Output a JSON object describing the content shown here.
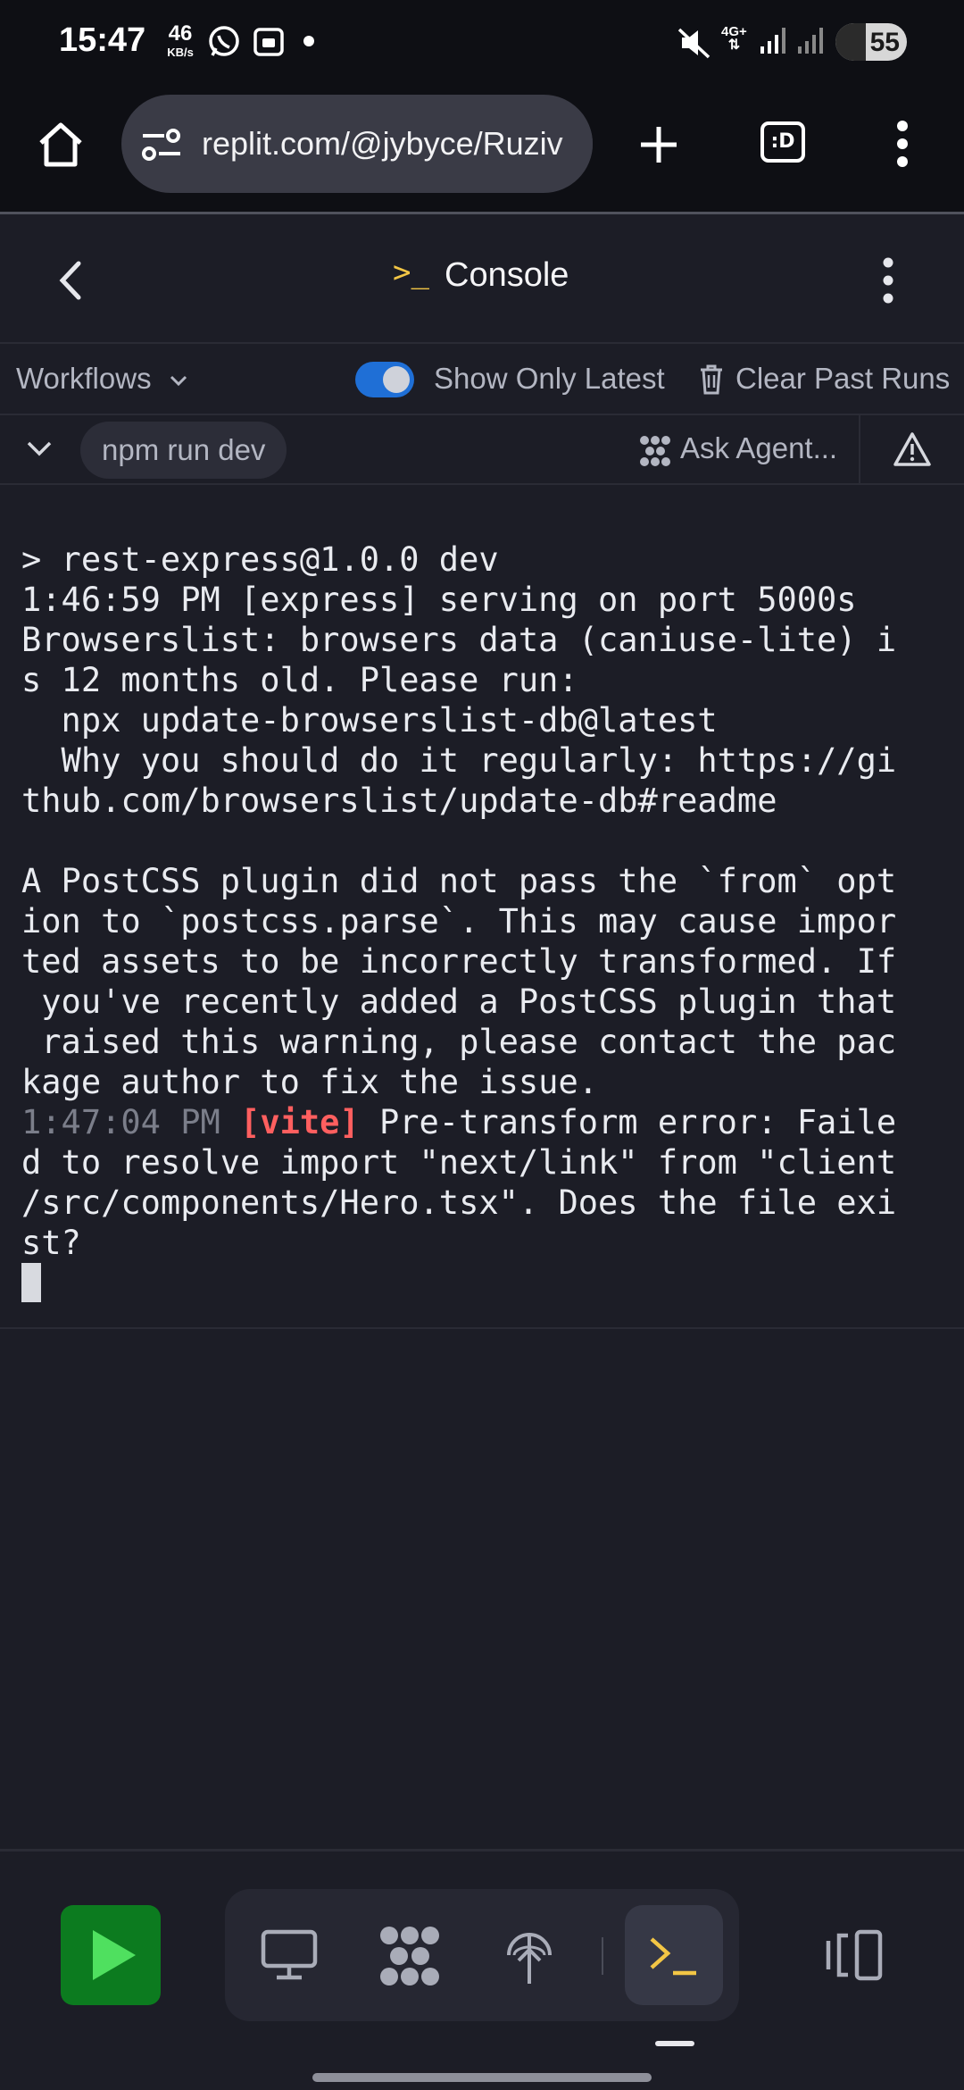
{
  "status_bar": {
    "time": "15:47",
    "speed_value": "46",
    "speed_unit": "KB/s",
    "network_type": "4G+",
    "battery": "55"
  },
  "browser": {
    "url": "replit.com/@jybyce/Ruziv",
    "tab_icon_label": ":D"
  },
  "console_header": {
    "prompt_symbol": ">_",
    "title": "Console"
  },
  "toolbar": {
    "workflows_label": "Workflows",
    "show_only_latest_label": "Show Only Latest",
    "show_only_latest_on": true,
    "clear_past_runs_label": "Clear Past Runs"
  },
  "run_row": {
    "command": "npm run dev",
    "ask_agent_label": "Ask Agent..."
  },
  "terminal": {
    "lines": [
      "> rest-express@1.0.0 dev",
      "1:46:59 PM [express] serving on port 5000s",
      "Browserslist: browsers data (caniuse-lite) i",
      "s 12 months old. Please run:",
      "  npx update-browserslist-db@latest",
      "  Why you should do it regularly: https://gi",
      "thub.com/browserslist/update-db#readme",
      "",
      "A PostCSS plugin did not pass the `from` opt",
      "ion to `postcss.parse`. This may cause impor",
      "ted assets to be incorrectly transformed. If",
      " you've recently added a PostCSS plugin that",
      " raised this warning, please contact the pac",
      "kage author to fix the issue."
    ],
    "vite_timestamp": "1:47:04 PM",
    "vite_tag": "[vite]",
    "vite_line_rest": " Pre-transform error: Faile",
    "error_lines": [
      "d to resolve import \"next/link\" from \"client",
      "/src/components/Hero.tsx\". Does the file exi",
      "st?"
    ]
  },
  "colors": {
    "background": "#1c1d26",
    "accent_blue": "#1f6fd6",
    "prompt_yellow": "#f3c645",
    "run_green": "#0c7b1f",
    "error_red": "#ff5f5f"
  },
  "icons": {
    "status_bar": [
      "whatsapp-icon",
      "screenshot-icon",
      "mute-icon",
      "signal-icon"
    ],
    "browser": [
      "home-icon",
      "site-settings-icon",
      "new-tab-plus-icon",
      "tab-switcher-icon",
      "overflow-menu-icon"
    ],
    "console": [
      "back-chevron-icon",
      "console-prompt-icon",
      "more-vert-icon"
    ],
    "bottom_nav": [
      "run-play-icon",
      "webview-monitor-icon",
      "agent-icon",
      "deploy-icon",
      "console-prompt-icon",
      "panels-icon"
    ]
  }
}
